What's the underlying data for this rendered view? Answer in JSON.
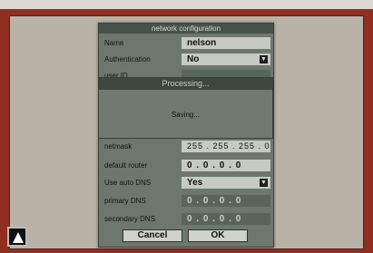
{
  "dialog": {
    "title": "network configuration",
    "name": {
      "label": "Name",
      "value": "nelson"
    },
    "authentication": {
      "label": "Authentication",
      "value": "No"
    },
    "user_id": {
      "label": "user ID"
    },
    "netmask": {
      "label": "netmask",
      "value": "255 . 255 . 255 . 0"
    },
    "default_router": {
      "label": "default router",
      "value": "0 . 0 . 0 . 0"
    },
    "use_auto_dns": {
      "label": "Use auto DNS",
      "value": "Yes"
    },
    "primary_dns": {
      "label": "primary DNS",
      "value": "0 . 0 . 0 . 0"
    },
    "secondary_dns": {
      "label": "secondary DNS",
      "value": "0 . 0 . 0 . 0"
    },
    "cancel_label": "Cancel",
    "ok_label": "OK"
  },
  "processing": {
    "title": "Processing...",
    "message": "Saving..."
  },
  "icons": {
    "dropdown": "chevron-down-icon",
    "nav": "up-arrow-icon"
  }
}
